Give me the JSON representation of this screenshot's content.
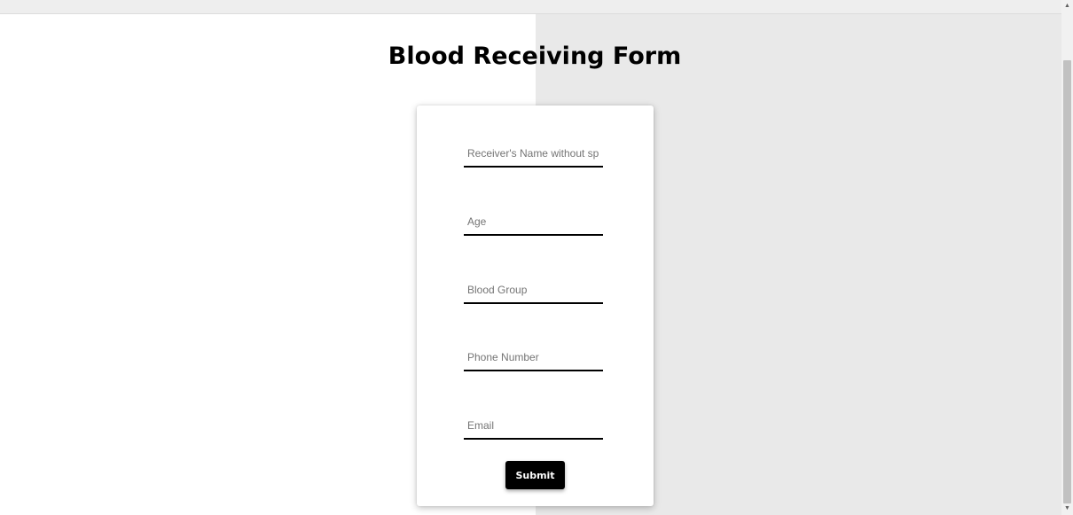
{
  "page": {
    "title": "Blood Receiving Form"
  },
  "form": {
    "fields": [
      {
        "placeholder": "Receiver's Name without sp"
      },
      {
        "placeholder": "Age"
      },
      {
        "placeholder": "Blood Group"
      },
      {
        "placeholder": "Phone Number"
      },
      {
        "placeholder": "Email"
      }
    ],
    "submit_label": "Submit"
  },
  "icons": {
    "scroll_up": "scroll-up-arrow-icon",
    "scroll_down": "scroll-down-arrow-icon"
  },
  "colors": {
    "button_bg": "#000000",
    "button_text": "#ffffff",
    "right_panel_bg": "#e9e9e9"
  }
}
